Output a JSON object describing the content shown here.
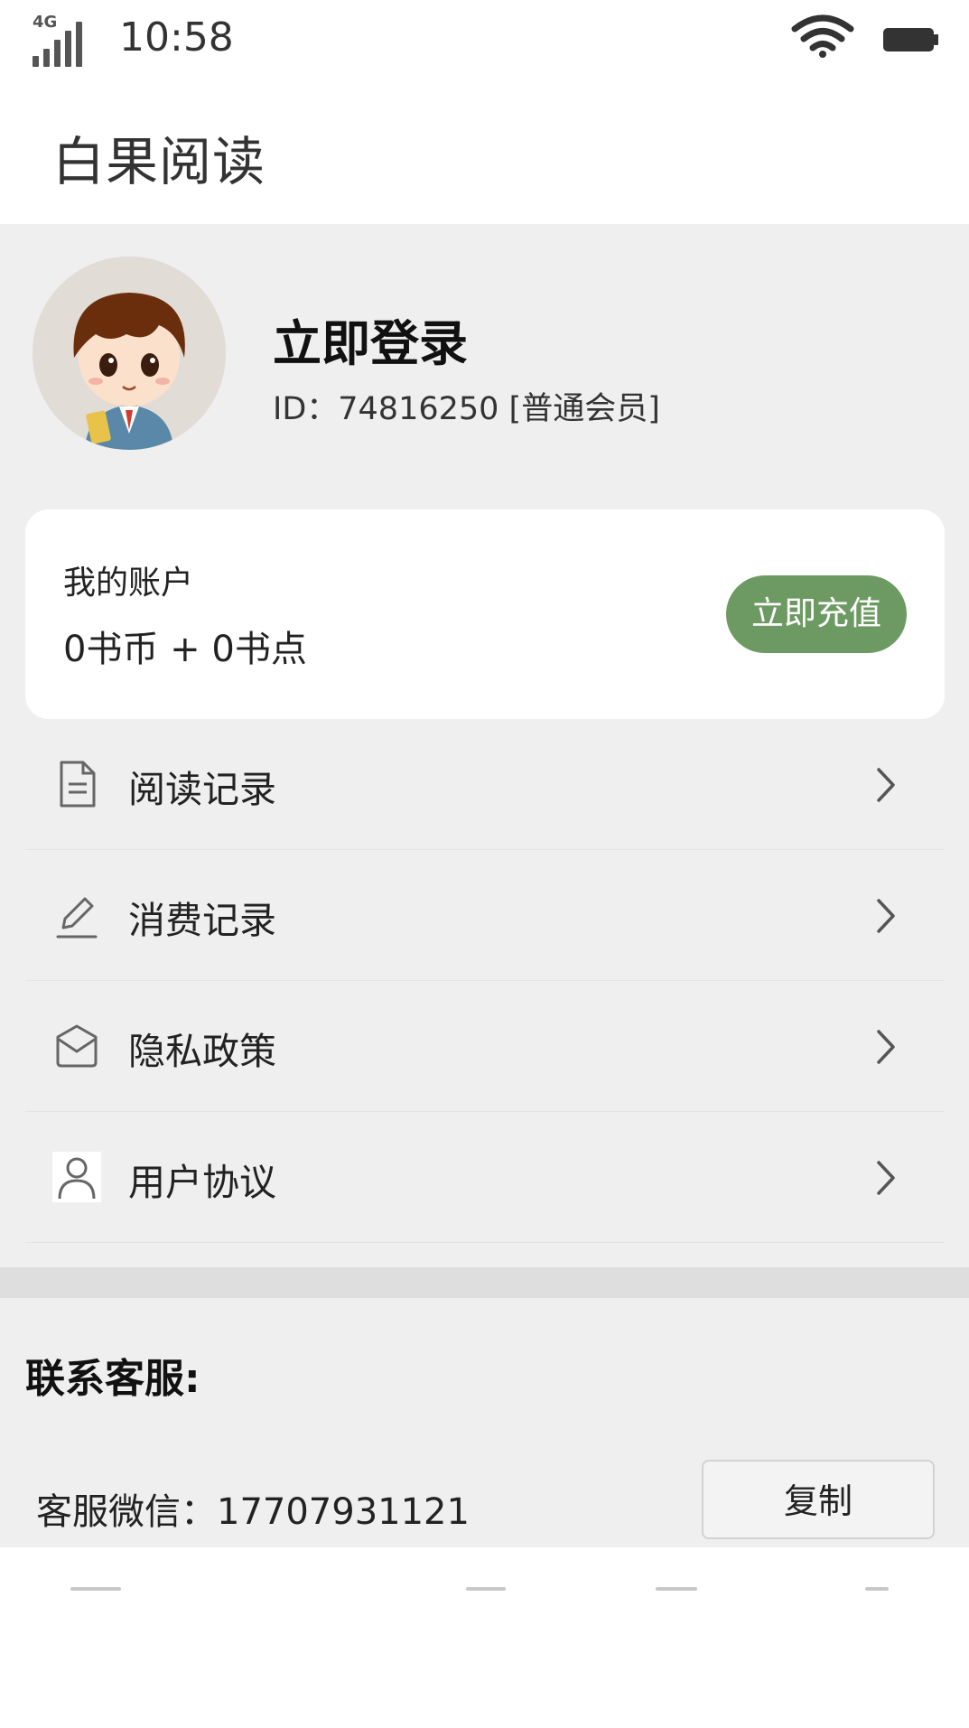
{
  "status_bar": {
    "network": "4G",
    "time": "10:58",
    "icons": [
      "signal-icon",
      "wifi-icon",
      "battery-icon"
    ]
  },
  "header": {
    "app_title": "白果阅读"
  },
  "profile": {
    "login_label": "立即登录",
    "user_id": "ID：74816250 [普通会员]",
    "avatar_icon": "cartoon-boy-avatar"
  },
  "account": {
    "title": "我的账户",
    "balance": "0书币 + 0书点",
    "recharge_label": "立即充值"
  },
  "menu": {
    "items": [
      {
        "label": "阅读记录",
        "icon": "document-icon"
      },
      {
        "label": "消费记录",
        "icon": "pencil-icon"
      },
      {
        "label": "隐私政策",
        "icon": "envelope-icon"
      },
      {
        "label": "用户协议",
        "icon": "user-icon"
      }
    ]
  },
  "contact": {
    "title": "联系客服:",
    "wechat": "客服微信：17707931121",
    "copy_label": "复制"
  },
  "colors": {
    "accent": "#6d9a62",
    "background": "#efefef",
    "card": "#ffffff"
  }
}
